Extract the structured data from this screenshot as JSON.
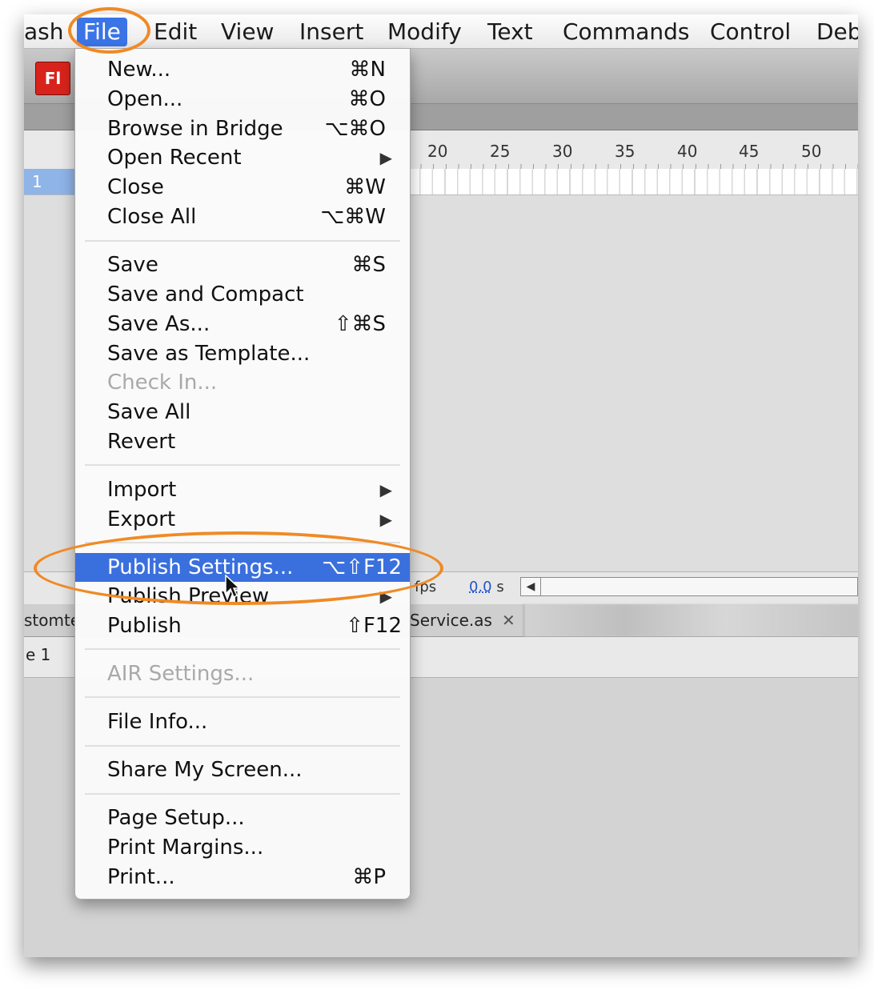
{
  "menubar": {
    "items": [
      "ash",
      "File",
      "Edit",
      "View",
      "Insert",
      "Modify",
      "Text",
      "Commands",
      "Control",
      "Deb"
    ]
  },
  "toolbar": {
    "app_logo": "Fl"
  },
  "timeline": {
    "ruler": [
      "20",
      "25",
      "30",
      "35",
      "40",
      "45",
      "50"
    ],
    "layer_label": "1"
  },
  "status": {
    "fps_label": "fps",
    "time_value": "0.0",
    "time_unit": "s"
  },
  "tabs": [
    {
      "label": "stomte"
    },
    {
      "label": "Service.as",
      "close": "✕"
    }
  ],
  "scene": {
    "label": "e 1"
  },
  "file_menu": {
    "items": [
      {
        "label": "New...",
        "shortcut": "⌘N"
      },
      {
        "label": "Open...",
        "shortcut": "⌘O"
      },
      {
        "label": "Browse in Bridge",
        "shortcut": "⌥⌘O"
      },
      {
        "label": "Open Recent",
        "submenu": "▶"
      },
      {
        "label": "Close",
        "shortcut": "⌘W"
      },
      {
        "label": "Close All",
        "shortcut": "⌥⌘W"
      },
      {
        "label": "Save",
        "shortcut": "⌘S"
      },
      {
        "label": "Save and Compact"
      },
      {
        "label": "Save As...",
        "shortcut": "⇧⌘S"
      },
      {
        "label": "Save as Template..."
      },
      {
        "label": "Check In...",
        "disabled": true
      },
      {
        "label": "Save All"
      },
      {
        "label": "Revert"
      },
      {
        "label": "Import",
        "submenu": "▶"
      },
      {
        "label": "Export",
        "submenu": "▶"
      },
      {
        "label": "Publish Settings...",
        "shortcut": "⌥⇧F12",
        "highlighted": true
      },
      {
        "label": "Publish Preview",
        "submenu": "▶"
      },
      {
        "label": "Publish",
        "shortcut": "⇧F12"
      },
      {
        "label": "AIR Settings...",
        "disabled": true
      },
      {
        "label": "File Info..."
      },
      {
        "label": "Share My Screen..."
      },
      {
        "label": "Page Setup..."
      },
      {
        "label": "Print Margins..."
      },
      {
        "label": "Print...",
        "shortcut": "⌘P"
      }
    ]
  },
  "colors": {
    "accent": "#3a6fde",
    "annotation": "#f08a24",
    "flash_red": "#d8231c"
  }
}
